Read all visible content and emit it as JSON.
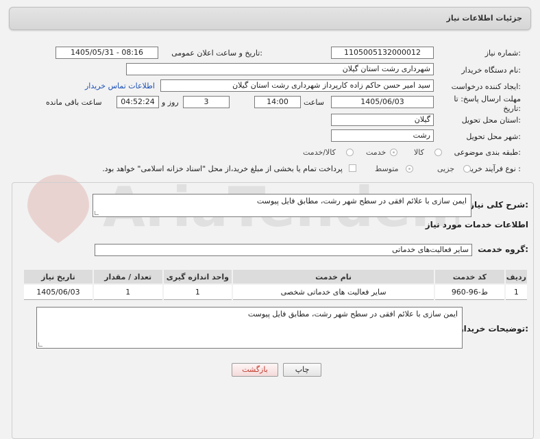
{
  "header": {
    "title": "جزئیات اطلاعات نیاز"
  },
  "fields": {
    "need_number_label": "شماره نیاز:",
    "need_number": "1105005132000012",
    "announce_label": "تاریخ و ساعت اعلان عمومی:",
    "announce_value": "1405/05/31 - 08:16",
    "buyer_org_label": "نام دستگاه خریدار:",
    "buyer_org": "شهرداری رشت استان گیلان",
    "creator_label": "ایجاد کننده درخواست:",
    "creator": "سید امیر حسن حاکم زاده کارپرداز  شهرداری رشت استان گیلان",
    "contact_link": "اطلاعات تماس خریدار",
    "deadline_label_line1": "مهلت ارسال پاسخ: تا",
    "deadline_label_line2": "تاریخ:",
    "deadline_date": "1405/06/03",
    "time_label": "ساعت",
    "deadline_time": "14:00",
    "days_value": "3",
    "days_label": "روز و",
    "remaining_time": "04:52:24",
    "remaining_label": "ساعت باقی مانده",
    "province_label": "استان محل تحویل:",
    "province": "گیلان",
    "city_label": "شهر محل تحویل:",
    "city": "رشت",
    "category_label": "طبقه بندی موضوعی:",
    "category_options": [
      "کالا",
      "خدمت",
      "کالا/خدمت"
    ],
    "category_selected": "خدمت",
    "process_label": "نوع فرآیند خرید :",
    "process_options": [
      "جزیی",
      "متوسط"
    ],
    "process_selected": "متوسط",
    "payment_note": "پرداخت تمام یا بخشی از مبلغ خرید،از محل \"اسناد خزانه اسلامی\" خواهد بود."
  },
  "description": {
    "label": "شرح کلی نیاز:",
    "value": "ایمن سازی با علائم افقی در سطح شهر رشت، مطابق فایل پیوست"
  },
  "services": {
    "section_title": "اطلاعات خدمات مورد نیاز",
    "group_label": "گروه خدمت:",
    "group_value": "سایر فعالیت‌های خدماتی",
    "columns": [
      "ردیف",
      "کد خدمت",
      "نام خدمت",
      "واحد اندازه گیری",
      "تعداد / مقدار",
      "تاریخ نیاز"
    ],
    "rows": [
      [
        "1",
        "ط-96-960",
        "سایر فعالیت های خدماتی شخصی",
        "1",
        "1",
        "1405/06/03"
      ]
    ]
  },
  "buyer_notes": {
    "label": "توضیحات خریدار:",
    "value": "ایمن سازی با علائم افقی در سطح شهر رشت، مطابق فایل پیوست"
  },
  "buttons": {
    "print": "چاپ",
    "back": "بازگشت"
  },
  "watermark_text": "AriaTender.net",
  "colors": {
    "link": "#1a4fb5",
    "back_button_text": "#c0392b",
    "header_bg": "#dcdcdc"
  }
}
